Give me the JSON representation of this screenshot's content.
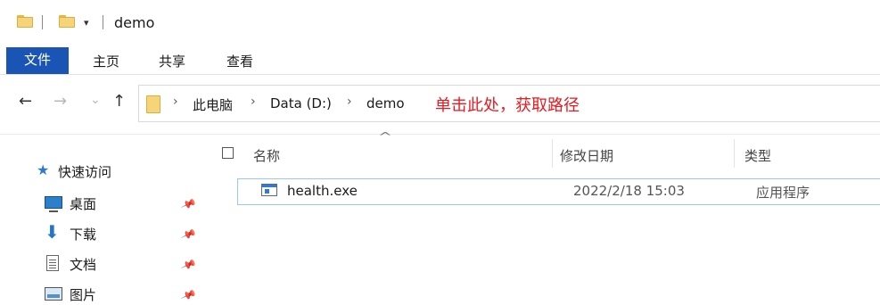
{
  "window": {
    "title": "demo"
  },
  "quick_access_toolbar": {
    "icons": [
      "folder-icon",
      "folder-icon",
      "customize-dropdown-icon"
    ]
  },
  "ribbon": {
    "tabs": [
      {
        "label": "文件",
        "active": true
      },
      {
        "label": "主页"
      },
      {
        "label": "共享"
      },
      {
        "label": "查看"
      }
    ],
    "accent_color": "#1a55b5"
  },
  "navigation": {
    "back_icon": "←",
    "forward_icon": "→",
    "recent_icon": "⌄",
    "up_icon": "↑",
    "breadcrumb": [
      "此电脑",
      "Data (D:)",
      "demo"
    ],
    "separator": "›"
  },
  "annotation": {
    "text": "单击此处，获取路径",
    "color": "#e8191f"
  },
  "nav_pane": {
    "quick_access": "快速访问",
    "items": [
      {
        "label": "桌面",
        "icon": "desktop-icon",
        "pinned": true
      },
      {
        "label": "下载",
        "icon": "download-icon",
        "pinned": true
      },
      {
        "label": "文档",
        "icon": "documents-icon",
        "pinned": true
      },
      {
        "label": "图片",
        "icon": "pictures-icon",
        "pinned": true
      }
    ],
    "pin_glyph": "📌"
  },
  "file_list": {
    "columns": [
      "名称",
      "修改日期",
      "类型"
    ],
    "rows": [
      {
        "name": "health.exe",
        "modified": "2022/2/18 15:03",
        "type": "应用程序",
        "icon": "application-icon"
      }
    ]
  }
}
